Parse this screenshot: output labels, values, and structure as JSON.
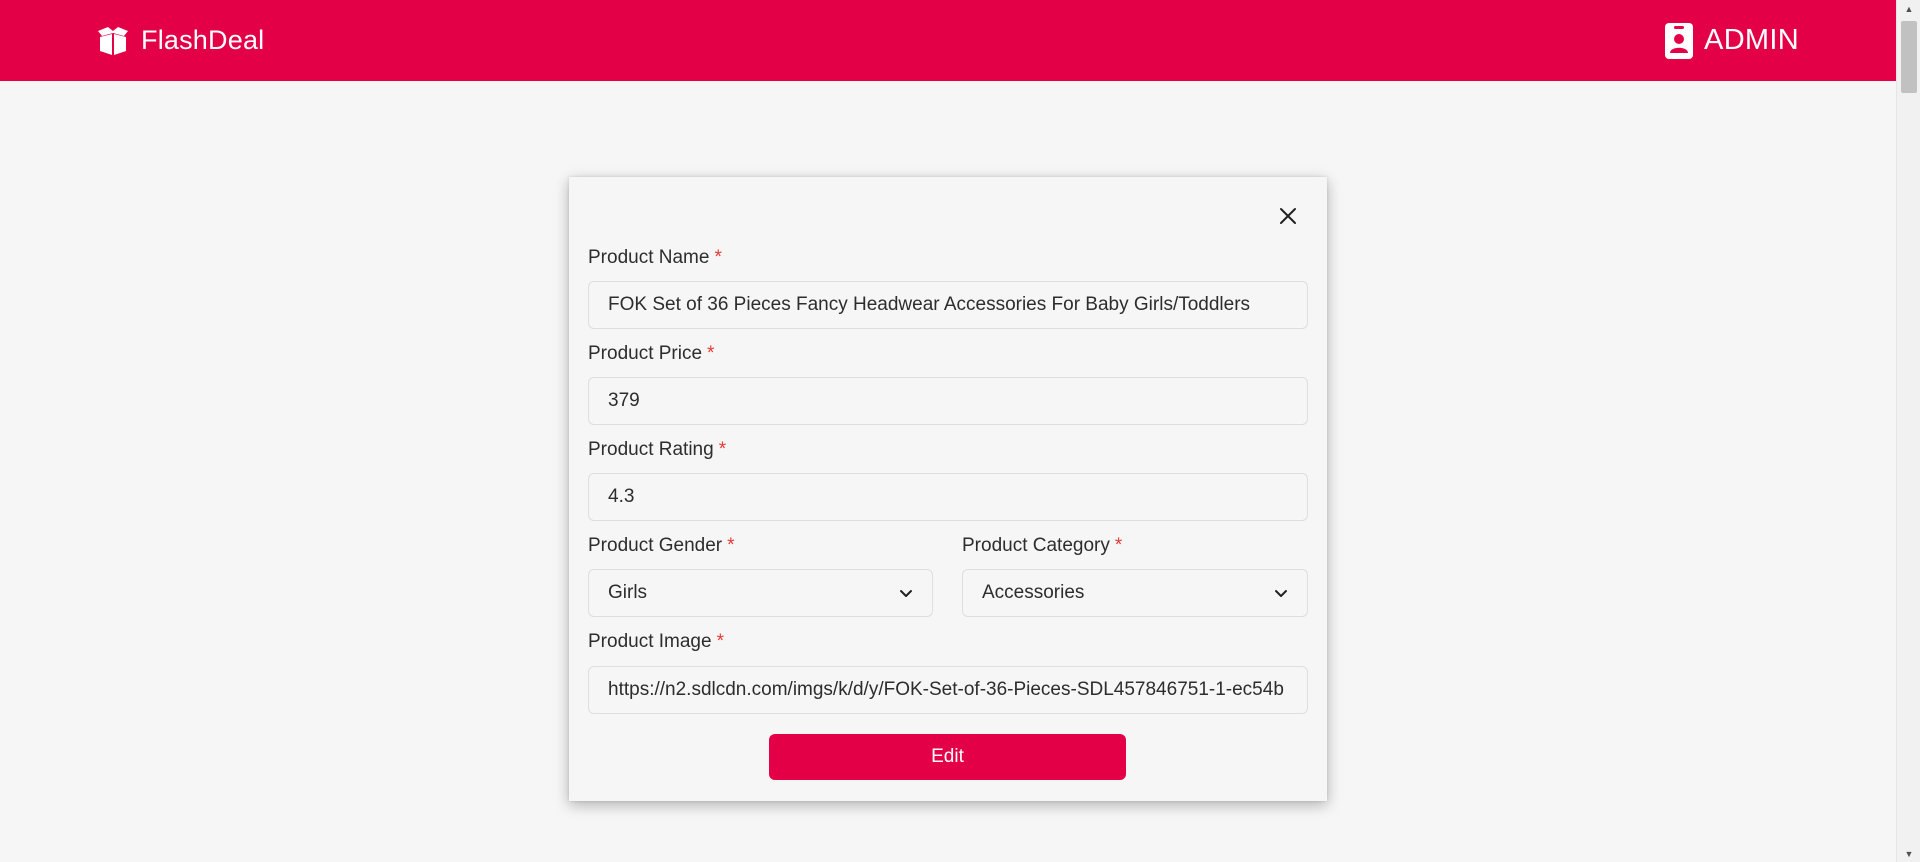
{
  "header": {
    "brand": "FlashDeal",
    "brand_icon": "box-open-icon",
    "account_label": "ADMIN",
    "account_icon": "id-badge-icon",
    "accent_color": "#e40046"
  },
  "form": {
    "close_icon": "close-icon",
    "product_name": {
      "label": "Product Name",
      "required": "*",
      "value": "FOK Set of 36 Pieces Fancy Headwear Accessories For Baby Girls/Toddlers"
    },
    "product_price": {
      "label": "Product Price",
      "required": "*",
      "value": "379"
    },
    "product_rating": {
      "label": "Product Rating",
      "required": "*",
      "value": "4.3"
    },
    "product_gender": {
      "label": "Product Gender",
      "required": "*",
      "selected": "Girls"
    },
    "product_category": {
      "label": "Product Category",
      "required": "*",
      "selected": "Accessories"
    },
    "product_image": {
      "label": "Product Image",
      "required": "*",
      "value": "https://n2.sdlcdn.com/imgs/k/d/y/FOK-Set-of-36-Pieces-SDL457846751-1-ec54b"
    },
    "submit_label": "Edit"
  }
}
